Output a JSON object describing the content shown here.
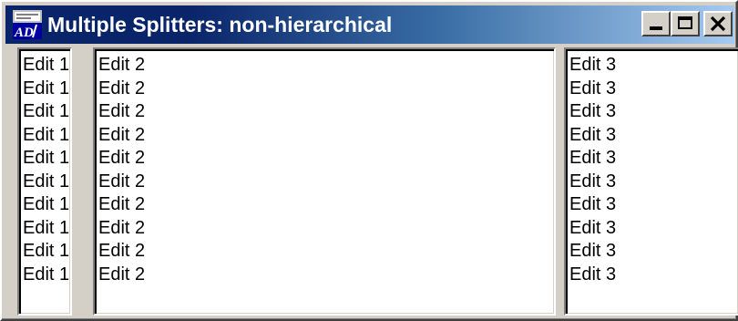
{
  "window": {
    "title": "Multiple Splitters: non-hierarchical",
    "icon": "app-icon",
    "caption_buttons": [
      "minimize-icon",
      "maximize-icon",
      "close-icon"
    ]
  },
  "panes": [
    {
      "name": "edit-pane-1",
      "lines": [
        "Edit 1",
        "Edit 1",
        "Edit 1",
        "Edit 1",
        "Edit 1",
        "Edit 1",
        "Edit 1",
        "Edit 1",
        "Edit 1",
        "Edit 1"
      ]
    },
    {
      "name": "edit-pane-2",
      "lines": [
        "Edit 2",
        "Edit 2",
        "Edit 2",
        "Edit 2",
        "Edit 2",
        "Edit 2",
        "Edit 2",
        "Edit 2",
        "Edit 2",
        "Edit 2"
      ]
    },
    {
      "name": "edit-pane-3",
      "lines": [
        "Edit 3",
        "Edit 3",
        "Edit 3",
        "Edit 3",
        "Edit 3",
        "Edit 3",
        "Edit 3",
        "Edit 3",
        "Edit 3",
        "Edit 3"
      ]
    }
  ],
  "colors": {
    "title_active": "#0a246a",
    "face": "#d4d0c8",
    "pane_bg": "#ffffff"
  }
}
